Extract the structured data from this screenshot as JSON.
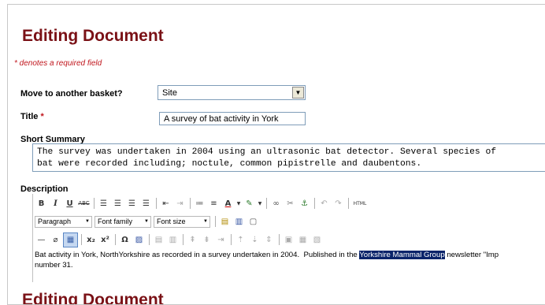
{
  "page": {
    "heading": "Editing Document",
    "heading_repeat": "Editing Document",
    "required_note": "* denotes a required field"
  },
  "fields": {
    "basket": {
      "label": "Move to another basket?",
      "value": "Site"
    },
    "title": {
      "label": "Title",
      "required_mark": "*",
      "value": "A survey of bat activity in York"
    },
    "summary": {
      "label": "Short Summary",
      "lines": [
        "The survey was undertaken in 2004 using an ultrasonic bat detector. Several species of",
        "bat were recorded including; noctule, common pipistrelle and daubentons."
      ]
    },
    "description": {
      "label": "Description",
      "format_dropdown": "Paragraph",
      "font_family_dropdown": "Font family",
      "font_size_dropdown": "Font size",
      "html_button": "HTML",
      "text_before": "Bat activity in York, NorthYorkshire as recorded in a survey undertaken in 2004.  Published in the ",
      "text_highlight": "Yorkshire Mammal Group",
      "text_after": " newsletter \"Imp",
      "text_line2": "number 31."
    }
  }
}
